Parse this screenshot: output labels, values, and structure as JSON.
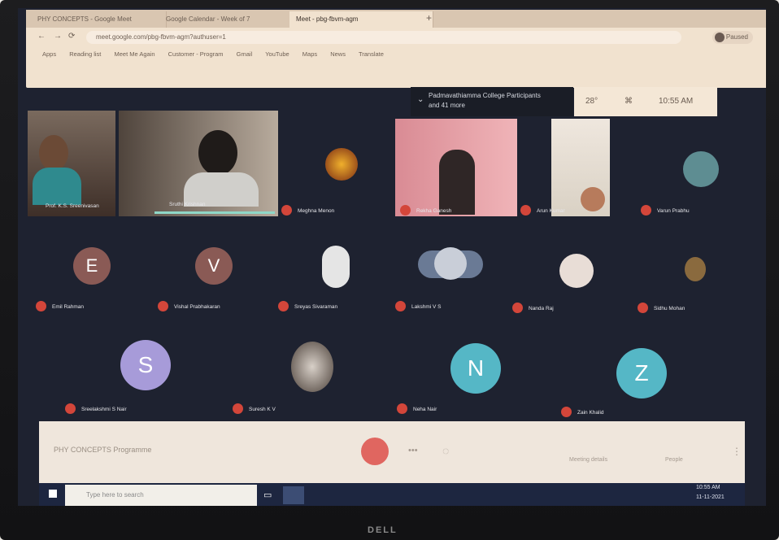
{
  "tabs": [
    "PHY CONCEPTS - Google Meet",
    "Google Calendar - Week of 7",
    "Meet - pbg-fbvm-agm"
  ],
  "url": "meet.google.com/pbg-fbvm-agm?authuser=1",
  "bookmarks": [
    "Apps",
    "Reading list",
    "Meet Me Again",
    "Customer - Program",
    "Gmail",
    "YouTube",
    "Maps",
    "News",
    "Translate"
  ],
  "profile": "Paused",
  "notification": {
    "line1": "Padmavathiamma College Participants",
    "line2": "and 41 more"
  },
  "system": {
    "temp": "28°",
    "time": "10:55 AM"
  },
  "participants": [
    {
      "name": "Prof. K.S. Sreenivasan",
      "kind": "video"
    },
    {
      "name": "Sruthi Krishnan",
      "kind": "video"
    },
    {
      "name": "Meghna Menon",
      "kind": "picture"
    },
    {
      "name": "Rekha Ganesh",
      "kind": "video"
    },
    {
      "name": "Arun Kumar",
      "kind": "video"
    },
    {
      "name": "Varun Prabhu",
      "kind": "avatar"
    },
    {
      "name": "Emil Rahman",
      "kind": "letter",
      "letter": "E"
    },
    {
      "name": "Vishal Prabhakaran",
      "kind": "letter",
      "letter": "V"
    },
    {
      "name": "Sreyas Sivaraman",
      "kind": "picture"
    },
    {
      "name": "Lakshmi V S",
      "kind": "picture"
    },
    {
      "name": "Nanda Raj",
      "kind": "picture"
    },
    {
      "name": "Sidhu Mohan",
      "kind": "picture"
    },
    {
      "name": "Sreelakshmi S Nair",
      "kind": "letter",
      "letter": "S"
    },
    {
      "name": "Suresh K V",
      "kind": "picture"
    },
    {
      "name": "Neha Nair",
      "kind": "letter",
      "letter": "N"
    },
    {
      "name": "Zain Khalid",
      "kind": "letter",
      "letter": "Z"
    }
  ],
  "controls": {
    "meeting_name": "PHY CONCEPTS Programme",
    "details": "Meeting details",
    "people": "People",
    "chat": "Chat"
  },
  "taskbar": {
    "search_placeholder": "Type here to search",
    "datetime": "10:55 AM",
    "date": "11-11-2021"
  },
  "monitor_brand": "DELL",
  "colors": {
    "letter_E": "#8a5a55",
    "letter_V": "#8a5a55",
    "letter_S": "#a79bd9",
    "letter_N": "#55b7c6",
    "letter_Z": "#55b7c6",
    "mic": "#d3463a",
    "end_call": "#e06660"
  }
}
